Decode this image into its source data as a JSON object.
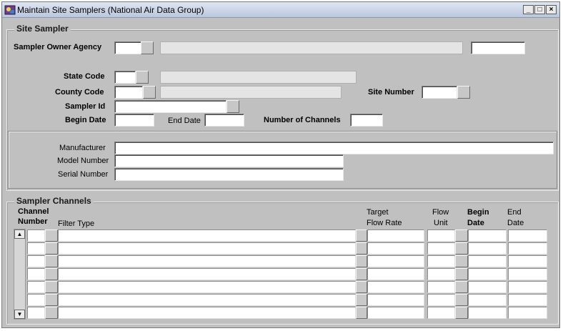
{
  "window": {
    "title": "Maintain Site Samplers (National Air Data Group)",
    "icon": "oracle-forms-app-icon",
    "controls": [
      "minimize-icon",
      "restore-icon",
      "close-icon"
    ]
  },
  "site_sampler": {
    "group_title": "Site Sampler",
    "sampler_owner_agency_label": "Sampler Owner Agency",
    "state_code_label": "State Code",
    "county_code_label": "County Code",
    "site_number_label": "Site Number",
    "sampler_id_label": "Sampler Id",
    "begin_date_label": "Begin Date",
    "end_date_label": "End Date",
    "number_of_channels_label": "Number of Channels",
    "manufacturer_label": "Manufacturer",
    "model_number_label": "Model Number",
    "serial_number_label": "Serial Number",
    "values": {
      "sampler_owner_agency": "",
      "agency_name": "",
      "agency_extra": "",
      "state_code": "",
      "state_name": "",
      "county_code": "",
      "county_name": "",
      "site_number": "",
      "sampler_id": "",
      "begin_date": "",
      "end_date": "",
      "number_of_channels": "",
      "manufacturer": "",
      "model_number": "",
      "serial_number": ""
    }
  },
  "sampler_channels": {
    "group_title": "Sampler Channels",
    "columns": {
      "channel_number_1": "Channel",
      "channel_number_2": "Number",
      "filter_type": "Filter Type",
      "target_flow_rate_1": "Target",
      "target_flow_rate_2": "Flow Rate",
      "flow_unit_1": "Flow",
      "flow_unit_2": "Unit",
      "begin_date_1": "Begin",
      "begin_date_2": "Date",
      "end_date_1": "End",
      "end_date_2": "Date"
    },
    "rows": [
      {
        "channel_number": "",
        "filter_type": "",
        "target_flow_rate": "",
        "flow_unit": "",
        "begin_date": "",
        "end_date": ""
      },
      {
        "channel_number": "",
        "filter_type": "",
        "target_flow_rate": "",
        "flow_unit": "",
        "begin_date": "",
        "end_date": ""
      },
      {
        "channel_number": "",
        "filter_type": "",
        "target_flow_rate": "",
        "flow_unit": "",
        "begin_date": "",
        "end_date": ""
      },
      {
        "channel_number": "",
        "filter_type": "",
        "target_flow_rate": "",
        "flow_unit": "",
        "begin_date": "",
        "end_date": ""
      },
      {
        "channel_number": "",
        "filter_type": "",
        "target_flow_rate": "",
        "flow_unit": "",
        "begin_date": "",
        "end_date": ""
      },
      {
        "channel_number": "",
        "filter_type": "",
        "target_flow_rate": "",
        "flow_unit": "",
        "begin_date": "",
        "end_date": ""
      },
      {
        "channel_number": "",
        "filter_type": "",
        "target_flow_rate": "",
        "flow_unit": "",
        "begin_date": "",
        "end_date": ""
      }
    ]
  }
}
